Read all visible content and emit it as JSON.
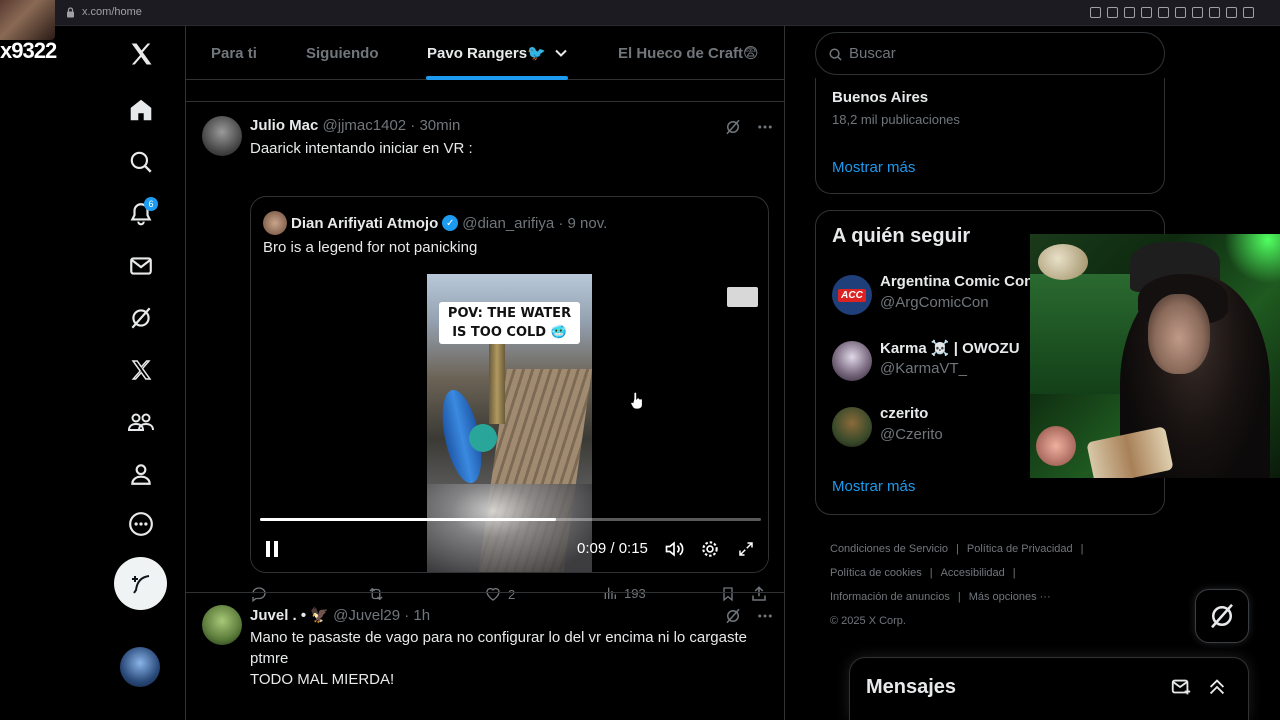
{
  "browser": {
    "url": "x.com/home"
  },
  "overlay": {
    "stream_text": "x9322"
  },
  "nav": {
    "notifications_badge": "6",
    "items": [
      "x-logo-icon",
      "home-icon",
      "search-icon",
      "bell-icon",
      "mail-icon",
      "grok-icon",
      "x-premium-icon",
      "communities-icon",
      "profile-icon",
      "more-icon"
    ]
  },
  "tabs": {
    "items": [
      {
        "label": "Para ti",
        "active": false
      },
      {
        "label": "Siguiendo",
        "active": false
      },
      {
        "label": "Pavo Rangers🐦",
        "active": true
      },
      {
        "label": "El Hueco de Craft😨",
        "active": false
      }
    ]
  },
  "tweet1": {
    "name": "Julio Mac",
    "meta": "@jjmac1402 · 30min",
    "text": "Daarick intentando iniciar en VR :",
    "quote": {
      "name": "Dian Arifiyati Atmojo",
      "meta": "@dian_arifiya · 9 nov.",
      "text": "Bro is a legend for not panicking",
      "video_caption": "POV: THE WATER IS TOO COLD 🥶",
      "time": "0:09 / 0:15",
      "progress": 0.59
    },
    "actions": {
      "replies": "",
      "retweets": "",
      "likes": "2",
      "views": "193"
    }
  },
  "tweet2": {
    "name": "Juvel . •",
    "emoji": "🦅",
    "meta": "@Juvel29 · 1h",
    "text_line1": "Mano te pasaste de vago para no configurar lo del vr encima ni lo cargaste",
    "text_line2": "ptmre",
    "text_line3": "TODO MAL MIERDA!"
  },
  "right": {
    "search_placeholder": "Buscar",
    "trend": {
      "location": "Buenos Aires",
      "count": "18,2 mil publicaciones",
      "show_more": "Mostrar más"
    },
    "who_to_follow": {
      "title": "A quién seguir",
      "accounts": [
        {
          "name": "Argentina Comic Con",
          "handle": "@ArgComicCon"
        },
        {
          "name": "Karma ☠️ | OWOZU",
          "handle": "@KarmaVT_"
        },
        {
          "name": "czerito",
          "handle": "@Czerito"
        }
      ],
      "show_more": "Mostrar más"
    },
    "footer": {
      "terms": "Condiciones de Servicio",
      "privacy": "Política de Privacidad",
      "cookies": "Política de cookies",
      "accessibility": "Accesibilidad",
      "ads": "Información de anuncios",
      "more": "Más opciones ···",
      "copyright": "© 2025 X Corp."
    },
    "messages_title": "Mensajes"
  },
  "colors": {
    "accent": "#1d9bf0",
    "background": "#000000",
    "border": "#2f3336",
    "text": "#e7e9ea",
    "muted": "#71767b"
  }
}
